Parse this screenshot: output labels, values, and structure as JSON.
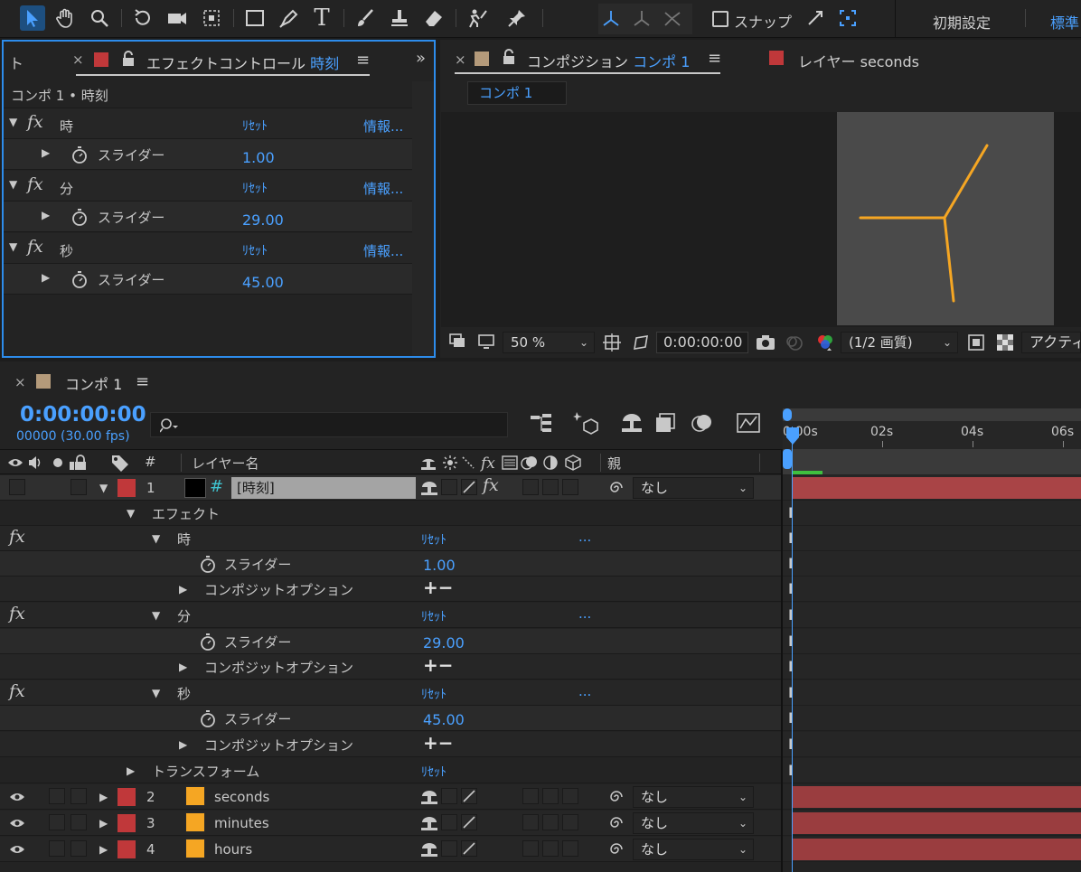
{
  "toolbar": {
    "snap_label": "スナップ",
    "workspace_default": "初期設定",
    "workspace_standard": "標準"
  },
  "effect_controls": {
    "tab_left_stub": "ト",
    "tab_title": "エフェクトコントロール",
    "tab_layer": "時刻",
    "breadcrumb": "コンポ 1 • 時刻",
    "effects": [
      {
        "name": "時",
        "reset": "ﾘｾｯﾄ",
        "info": "情報...",
        "prop": "スライダー",
        "value": "1.00"
      },
      {
        "name": "分",
        "reset": "ﾘｾｯﾄ",
        "info": "情報...",
        "prop": "スライダー",
        "value": "29.00"
      },
      {
        "name": "秒",
        "reset": "ﾘｾｯﾄ",
        "info": "情報...",
        "prop": "スライダー",
        "value": "45.00"
      }
    ]
  },
  "composition": {
    "tab_title": "コンポジション",
    "tab_comp": "コンポ 1",
    "layer_tab": "レイヤー seconds",
    "comp_chip": "コンポ 1",
    "zoom": "50 %",
    "timecode": "0:00:00:00",
    "quality": "(1/2 画質)",
    "active_camera": "アクティ",
    "clock_color": "#f5a623"
  },
  "timeline": {
    "tab_title": "コンポ 1",
    "timecode": "0:00:00:00",
    "frames": "00000 (30.00 fps)",
    "col_num": "#",
    "col_layer_name": "レイヤー名",
    "col_parent": "親",
    "ruler": [
      "0:00s",
      "02s",
      "04s",
      "06s"
    ],
    "layers": [
      {
        "index": "1",
        "name": "[時刻]",
        "parent": "なし"
      },
      {
        "index": "2",
        "name": "seconds",
        "parent": "なし"
      },
      {
        "index": "3",
        "name": "minutes",
        "parent": "なし"
      },
      {
        "index": "4",
        "name": "hours",
        "parent": "なし"
      }
    ],
    "effects_label": "エフェクト",
    "effect_rows": [
      {
        "name": "時",
        "reset": "ﾘｾｯﾄ",
        "more": "...",
        "prop": "スライダー",
        "value": "1.00",
        "comp_opt": "コンポジットオプション",
        "plusminus": "+−"
      },
      {
        "name": "分",
        "reset": "ﾘｾｯﾄ",
        "more": "...",
        "prop": "スライダー",
        "value": "29.00",
        "comp_opt": "コンポジットオプション",
        "plusminus": "+−"
      },
      {
        "name": "秒",
        "reset": "ﾘｾｯﾄ",
        "more": "...",
        "prop": "スライダー",
        "value": "45.00",
        "comp_opt": "コンポジットオプション",
        "plusminus": "+−"
      }
    ],
    "transform_label": "トランスフォーム",
    "transform_reset": "ﾘｾｯﾄ"
  }
}
